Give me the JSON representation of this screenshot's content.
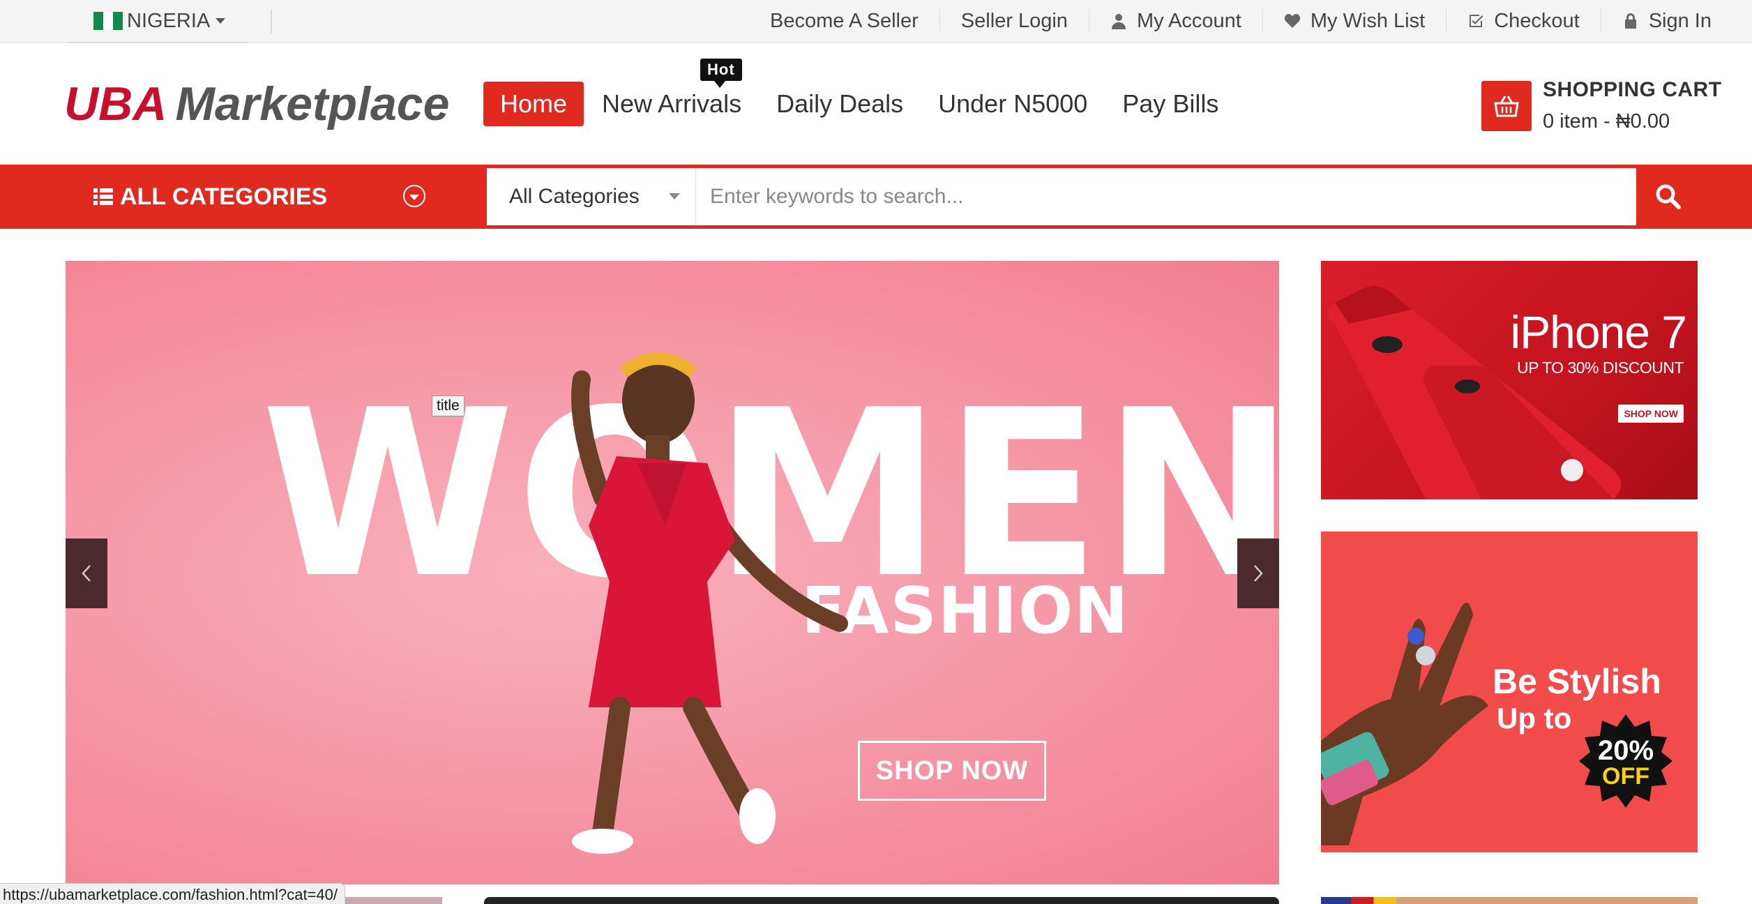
{
  "topbar": {
    "country": "NIGERIA",
    "links": {
      "become_seller": "Become A Seller",
      "seller_login": "Seller Login",
      "my_account": "My Account",
      "wish_list": "My Wish List",
      "checkout": "Checkout",
      "sign_in": "Sign In"
    }
  },
  "header": {
    "logo_primary": "UBA",
    "logo_secondary": "Marketplace",
    "nav": {
      "home": "Home",
      "new_arrivals": "New Arrivals",
      "daily_deals": "Daily Deals",
      "under": "Under N5000",
      "pay_bills": "Pay Bills"
    },
    "hot_badge": "Hot",
    "cart": {
      "title": "SHOPPING CART",
      "summary": "0 item - ₦0.00"
    }
  },
  "searchbar": {
    "all_categories": "ALL CATEGORIES",
    "category_select": "All Categories",
    "placeholder": "Enter keywords to search..."
  },
  "hero": {
    "headline": "WOMEN",
    "subheadline": "FASHION",
    "cta": "SHOP NOW",
    "tooltip": "title"
  },
  "banners": {
    "iphone": {
      "title": "iPhone 7",
      "subtitle": "UP TO 30% DISCOUNT",
      "cta": "SHOP NOW"
    },
    "stylish": {
      "title": "Be Stylish",
      "subtitle": "Up to",
      "percent": "20%",
      "off": "OFF"
    }
  },
  "statusbar": {
    "url": "https://ubamarketplace.com/fashion.html?cat=40/"
  },
  "colors": {
    "brand_red": "#e02a20",
    "logo_red": "#c8102e",
    "hero_pink": "#f69aa8",
    "stylish_bg": "#f24b4b"
  },
  "icons": [
    "user-icon",
    "heart-icon",
    "checkout-icon",
    "lock-icon",
    "basket-icon",
    "list-icon",
    "search-icon",
    "chevron-left-icon",
    "chevron-right-icon"
  ]
}
